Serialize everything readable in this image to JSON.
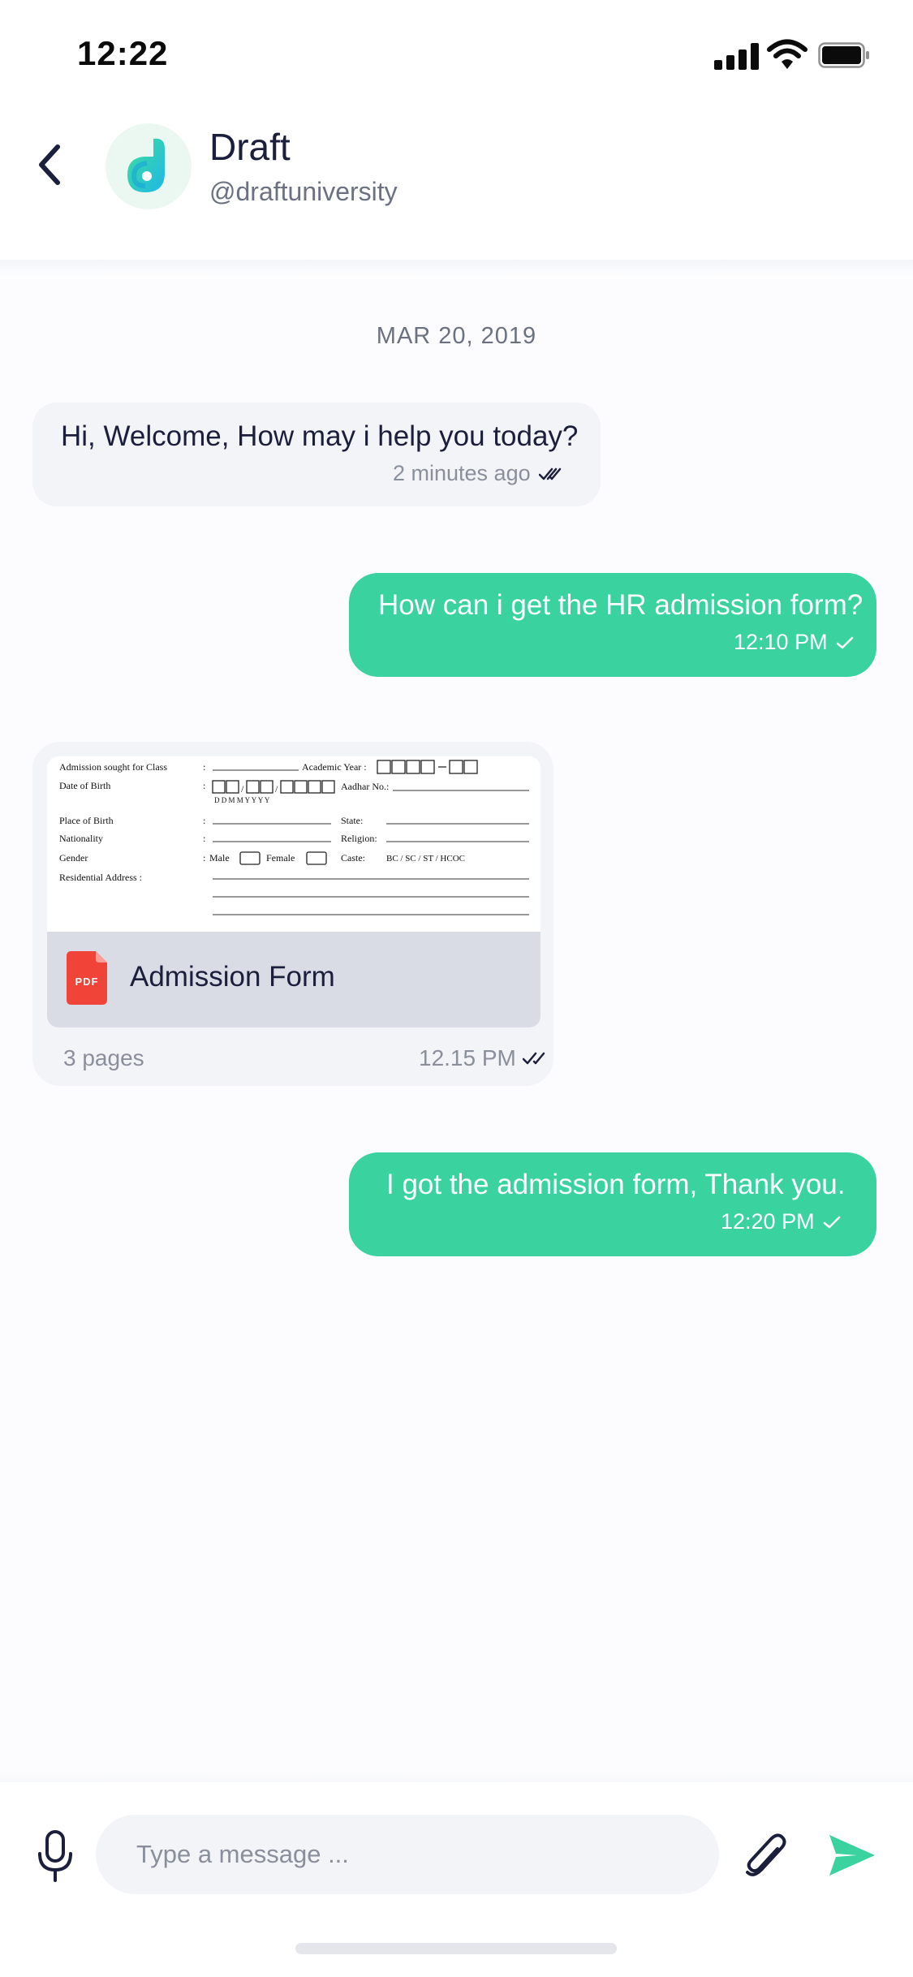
{
  "status_bar": {
    "time": "12:22"
  },
  "header": {
    "name": "Draft",
    "handle": "@draftuniversity"
  },
  "chat": {
    "date": "MAR 20, 2019",
    "messages": [
      {
        "text": "Hi, Welcome, How may i help you today?",
        "time": "2 minutes ago"
      },
      {
        "text": "How can i get the HR admission form?",
        "time": "12:10 PM"
      },
      {
        "file_name": "Admission Form",
        "file_type": "PDF",
        "pages": "3 pages",
        "time": "12.15 PM"
      },
      {
        "text": "I got the admission form, Thank you.",
        "time": "12:20 PM"
      }
    ],
    "doc_preview": {
      "class_label": "Admission sought for Class",
      "year_label": "Academic Year :",
      "dob_label": "Date of Birth",
      "dob_hint": "D  D     M  M     Y   Y   Y   Y",
      "aadhar_label": "Aadhar No.:",
      "pob_label": "Place of Birth",
      "state_label": "State:",
      "nationality_label": "Nationality",
      "religion_label": "Religion:",
      "gender_label": "Gender",
      "male_label": "Male",
      "female_label": "Female",
      "caste_label": "Caste:",
      "caste_value": "BC / SC / ST / HCOC",
      "address_label": "Residential Address :"
    }
  },
  "composer": {
    "placeholder": "Type a message ..."
  },
  "colors": {
    "accent": "#3AD29F",
    "incoming_bubble": "#F3F4F8",
    "pdf": "#F04438",
    "text_dark": "#1B1F3B"
  },
  "icons": [
    "back-icon",
    "draft-logo-icon",
    "double-check-icon",
    "check-icon",
    "pdf-icon",
    "mic-icon",
    "paperclip-icon",
    "send-icon"
  ]
}
